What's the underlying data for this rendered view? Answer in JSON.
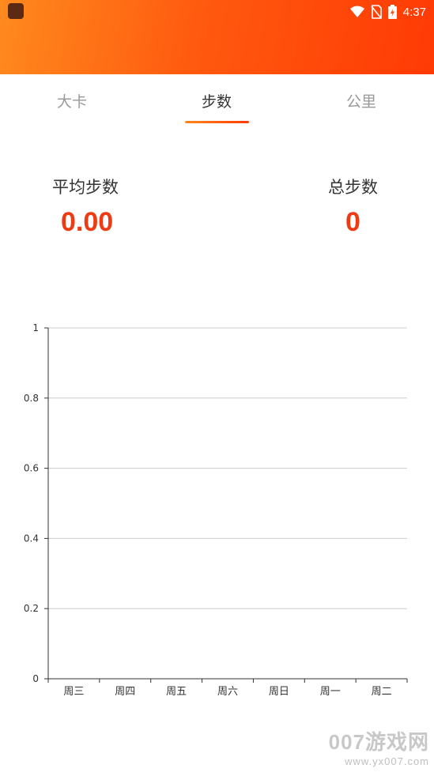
{
  "status_bar": {
    "time": "4:37",
    "icons": [
      "app-icon",
      "wifi-icon",
      "no-sim-icon",
      "battery-icon"
    ]
  },
  "tabs": [
    {
      "label": "大卡",
      "active": false
    },
    {
      "label": "步数",
      "active": true
    },
    {
      "label": "公里",
      "active": false
    }
  ],
  "stats": {
    "average_label": "平均步数",
    "average_value": "0.00",
    "total_label": "总步数",
    "total_value": "0"
  },
  "colors": {
    "accent": "#ee3b13",
    "header_start": "#ff8a1e",
    "header_end": "#ff3a05"
  },
  "chart_data": {
    "type": "bar",
    "categories": [
      "周三",
      "周四",
      "周五",
      "周六",
      "周日",
      "周一",
      "周二"
    ],
    "values": [
      0,
      0,
      0,
      0,
      0,
      0,
      0
    ],
    "yticks": [
      "0",
      "0.2",
      "0.4",
      "0.6",
      "0.8",
      "1"
    ],
    "ylim": [
      0,
      1
    ],
    "grid": true
  },
  "watermark": {
    "title": "007游戏网",
    "url": "www.yx007.com"
  }
}
